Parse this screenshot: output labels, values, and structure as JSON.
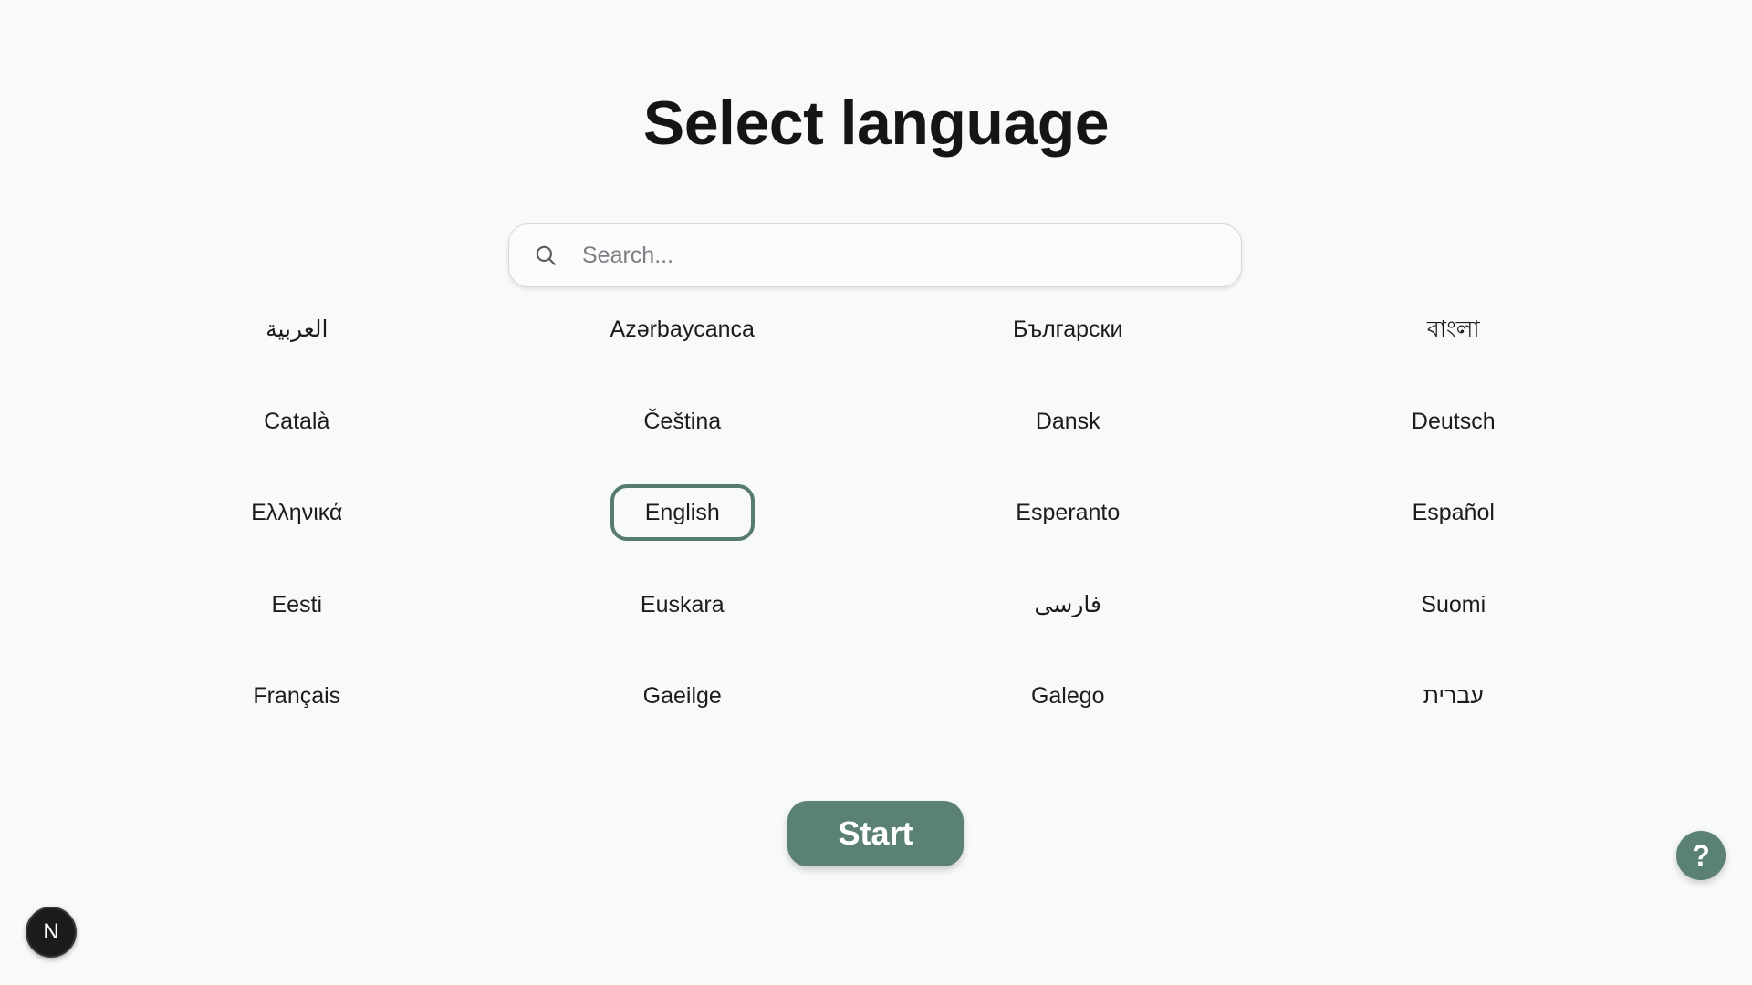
{
  "header": {
    "title": "Select language"
  },
  "search": {
    "placeholder": "Search...",
    "value": "",
    "icon": "search-icon"
  },
  "languages": [
    {
      "label": "العربية",
      "selected": false
    },
    {
      "label": "Azərbaycanca",
      "selected": false
    },
    {
      "label": "Български",
      "selected": false
    },
    {
      "label": "বাংলা",
      "selected": false
    },
    {
      "label": "Català",
      "selected": false
    },
    {
      "label": "Čeština",
      "selected": false
    },
    {
      "label": "Dansk",
      "selected": false
    },
    {
      "label": "Deutsch",
      "selected": false
    },
    {
      "label": "Ελληνικά",
      "selected": false
    },
    {
      "label": "English",
      "selected": true
    },
    {
      "label": "Esperanto",
      "selected": false
    },
    {
      "label": "Español",
      "selected": false
    },
    {
      "label": "Eesti",
      "selected": false
    },
    {
      "label": "Euskara",
      "selected": false
    },
    {
      "label": "فارسی",
      "selected": false
    },
    {
      "label": "Suomi",
      "selected": false
    },
    {
      "label": "Français",
      "selected": false
    },
    {
      "label": "Gaeilge",
      "selected": false
    },
    {
      "label": "Galego",
      "selected": false
    },
    {
      "label": "עברית",
      "selected": false
    }
  ],
  "actions": {
    "start_label": "Start",
    "help_label": "?",
    "badge_label": "N"
  },
  "colors": {
    "accent": "#5b8076",
    "selected_border": "#587b70",
    "background": "#f8f9fb"
  }
}
